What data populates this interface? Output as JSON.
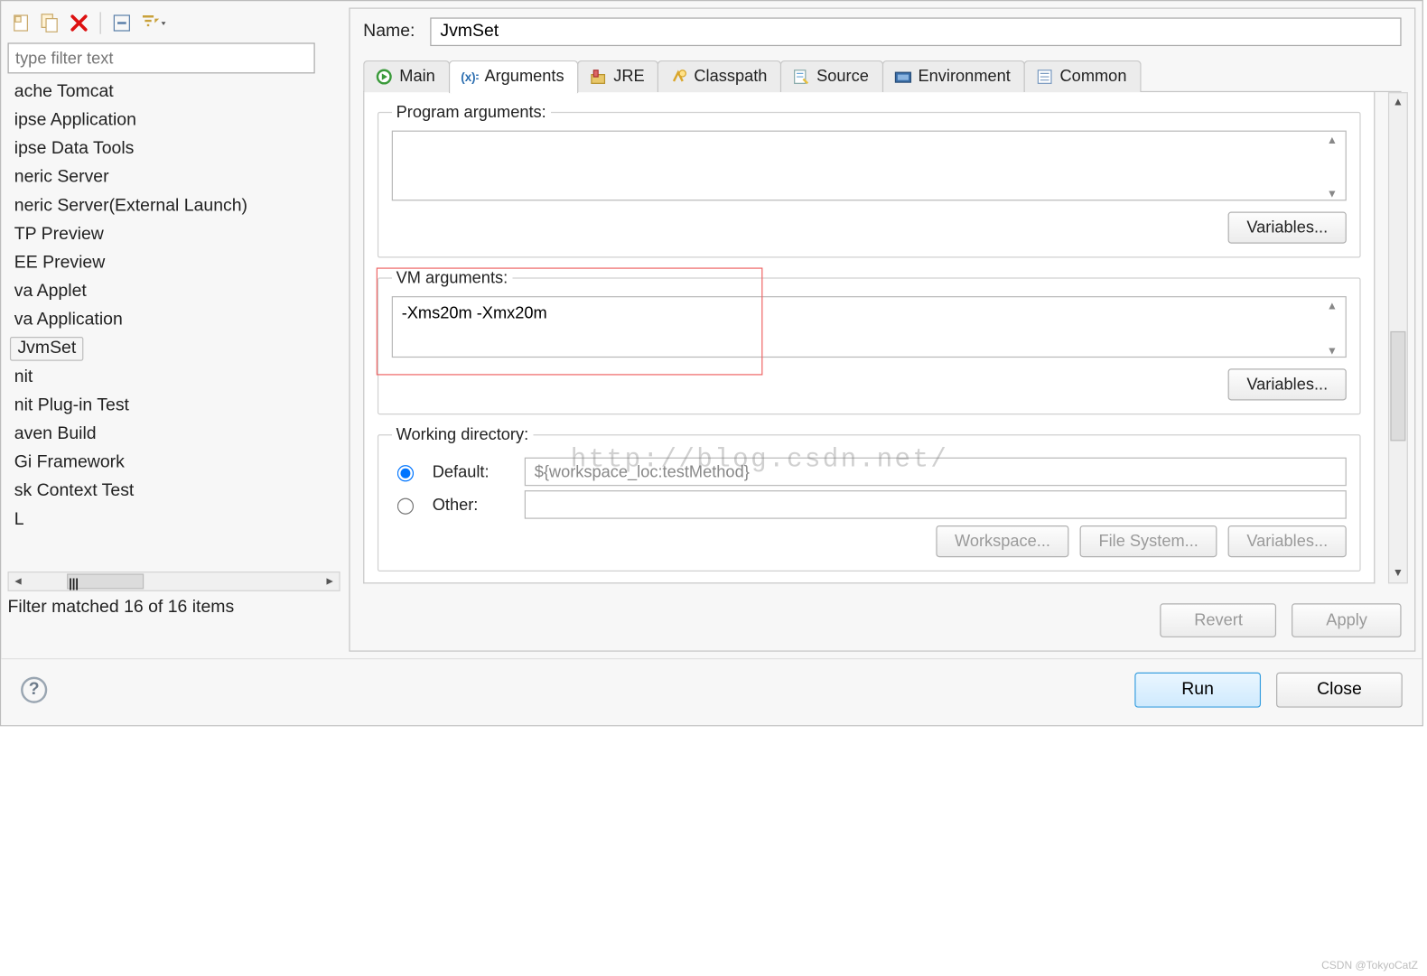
{
  "toolbar": {
    "filter_placeholder": "type filter text"
  },
  "tree": {
    "items": [
      "ache Tomcat",
      "ipse Application",
      "ipse Data Tools",
      "neric Server",
      "neric Server(External Launch)",
      "TP Preview",
      "EE Preview",
      "va Applet",
      "va Application",
      "JvmSet",
      "nit",
      "nit Plug-in Test",
      "aven Build",
      "Gi Framework",
      "sk Context Test",
      "L"
    ],
    "selected_index": 9,
    "filter_status": "Filter matched 16 of 16 items"
  },
  "config": {
    "name_label": "Name:",
    "name_value": "JvmSet"
  },
  "tabs": [
    {
      "label": "Main"
    },
    {
      "label": "Arguments"
    },
    {
      "label": "JRE"
    },
    {
      "label": "Classpath"
    },
    {
      "label": "Source"
    },
    {
      "label": "Environment"
    },
    {
      "label": "Common"
    }
  ],
  "active_tab": "Arguments",
  "arguments": {
    "program_label": "Program arguments:",
    "program_value": "",
    "vm_label": "VM arguments:",
    "vm_value": "-Xms20m -Xmx20m",
    "variables_label": "Variables..."
  },
  "working_dir": {
    "legend": "Working directory:",
    "default_label": "Default:",
    "default_value": "${workspace_loc:testMethod}",
    "other_label": "Other:",
    "workspace_btn": "Workspace...",
    "filesystem_btn": "File System...",
    "variables_btn": "Variables..."
  },
  "buttons": {
    "revert": "Revert",
    "apply": "Apply",
    "run": "Run",
    "close": "Close"
  },
  "watermark": "http://blog.csdn.net/",
  "credit": "CSDN @TokyoCatZ"
}
